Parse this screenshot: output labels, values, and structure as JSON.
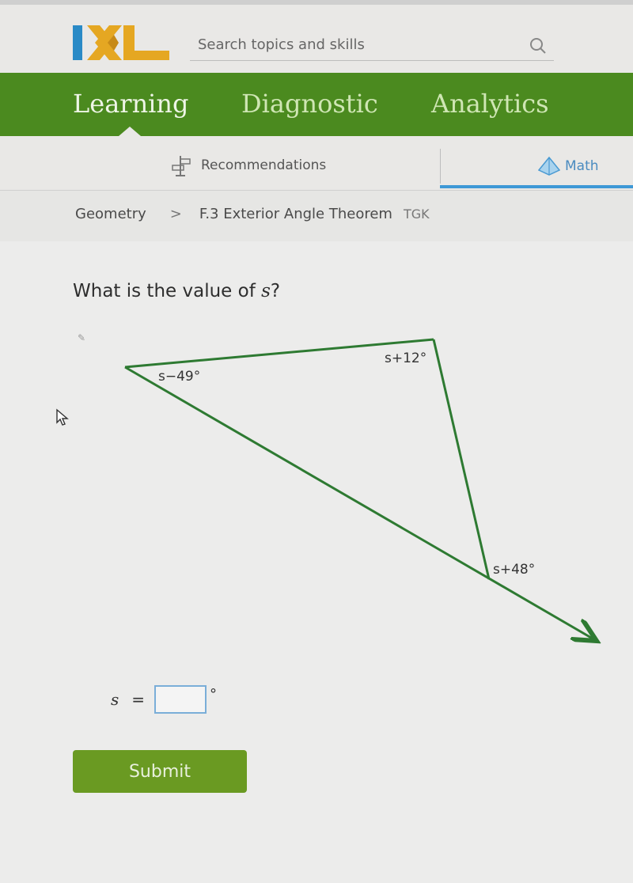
{
  "header": {
    "logo_text": "IXL",
    "search_placeholder": "Search topics and skills",
    "search_icon": "search-icon"
  },
  "nav": {
    "items": [
      {
        "label": "Learning",
        "active": true
      },
      {
        "label": "Diagnostic",
        "active": false
      },
      {
        "label": "Analytics",
        "active": false
      }
    ]
  },
  "subnav": {
    "recommendations_label": "Recommendations",
    "recommendations_icon": "signpost-icon",
    "subject_label": "Math",
    "subject_icon": "pyramid-icon"
  },
  "breadcrumb": {
    "subject": "Geometry",
    "separator": ">",
    "skill": "F.3 Exterior Angle Theorem",
    "code": "TGK"
  },
  "question": {
    "prefix": "What is the value of ",
    "variable": "s",
    "suffix": "?"
  },
  "diagram": {
    "angles": {
      "left_vertex": "s−49°",
      "top_right_vertex": "s+12°",
      "exterior": "s+48°"
    },
    "colors": {
      "line": "#2e7a32"
    }
  },
  "answer": {
    "variable": "s",
    "equals": "=",
    "value": "",
    "unit": "°"
  },
  "submit_label": "Submit",
  "colors": {
    "brand_green": "#4b8a1f",
    "submit_green": "#6a9a22",
    "accent_blue": "#3e98d6",
    "logo_blue": "#2a8ac6",
    "logo_yellow": "#e5a722"
  }
}
